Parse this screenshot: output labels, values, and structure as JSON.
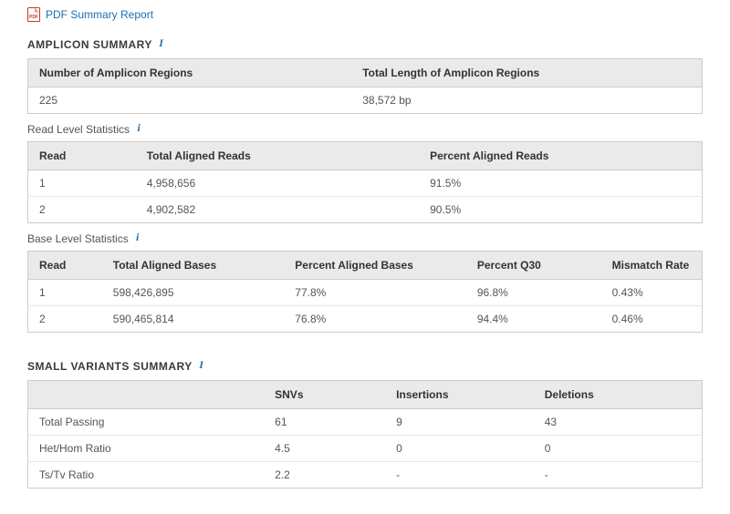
{
  "pdf_link": {
    "label": "PDF Summary Report"
  },
  "amplicon": {
    "title": "AMPLICON SUMMARY",
    "headers": {
      "num_regions": "Number of Amplicon Regions",
      "total_len": "Total Length of Amplicon Regions"
    },
    "values": {
      "num_regions": "225",
      "total_len": "38,572 bp"
    }
  },
  "read_stats": {
    "title": "Read Level Statistics",
    "headers": {
      "read": "Read",
      "total_aligned": "Total Aligned Reads",
      "percent_aligned": "Percent Aligned Reads"
    },
    "rows": [
      {
        "read": "1",
        "total_aligned": "4,958,656",
        "percent_aligned": "91.5%"
      },
      {
        "read": "2",
        "total_aligned": "4,902,582",
        "percent_aligned": "90.5%"
      }
    ]
  },
  "base_stats": {
    "title": "Base Level Statistics",
    "headers": {
      "read": "Read",
      "total_aligned": "Total Aligned Bases",
      "percent_aligned": "Percent Aligned Bases",
      "q30": "Percent Q30",
      "mismatch": "Mismatch Rate"
    },
    "rows": [
      {
        "read": "1",
        "total_aligned": "598,426,895",
        "percent_aligned": "77.8%",
        "q30": "96.8%",
        "mismatch": "0.43%"
      },
      {
        "read": "2",
        "total_aligned": "590,465,814",
        "percent_aligned": "76.8%",
        "q30": "94.4%",
        "mismatch": "0.46%"
      }
    ]
  },
  "small_variants": {
    "title": "SMALL VARIANTS SUMMARY",
    "headers": {
      "metric": "",
      "snvs": "SNVs",
      "insertions": "Insertions",
      "deletions": "Deletions"
    },
    "rows": [
      {
        "metric": "Total Passing",
        "snvs": "61",
        "insertions": "9",
        "deletions": "43"
      },
      {
        "metric": "Het/Hom Ratio",
        "snvs": "4.5",
        "insertions": "0",
        "deletions": "0"
      },
      {
        "metric": "Ts/Tv Ratio",
        "snvs": "2.2",
        "insertions": "-",
        "deletions": "-"
      }
    ]
  }
}
